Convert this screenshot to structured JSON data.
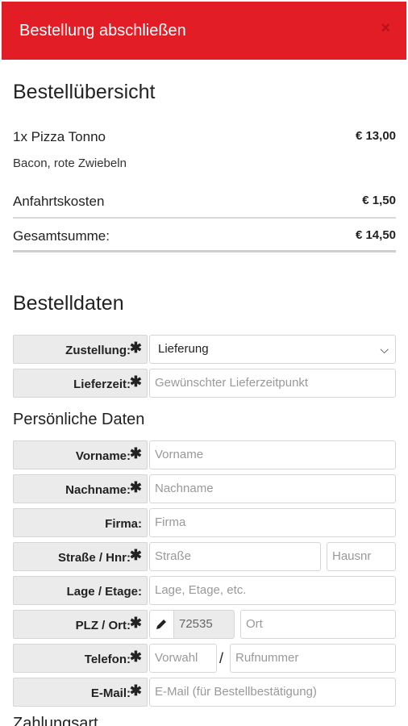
{
  "header": {
    "title": "Bestellung abschließen",
    "close_icon": "close-icon"
  },
  "summary": {
    "title": "Bestellübersicht",
    "item": {
      "name": "1x Pizza Tonno",
      "price": "€ 13,00",
      "extras": "Bacon, rote Zwiebeln"
    },
    "delivery": {
      "label": "Anfahrtskosten",
      "price": "€ 1,50"
    },
    "total": {
      "label": "Gesamtsumme:",
      "price": "€ 14,50"
    }
  },
  "order_data": {
    "title": "Bestelldaten",
    "delivery_type": {
      "label": "Zustellung:",
      "value": "Lieferung"
    },
    "delivery_time": {
      "label": "Lieferzeit:",
      "placeholder": "Gewünschter Lieferzeitpunkt"
    }
  },
  "personal": {
    "title": "Persönliche Daten",
    "firstname": {
      "label": "Vorname:",
      "placeholder": "Vorname"
    },
    "lastname": {
      "label": "Nachname:",
      "placeholder": "Nachname"
    },
    "company": {
      "label": "Firma:",
      "placeholder": "Firma"
    },
    "street": {
      "label": "Straße / Hnr:",
      "placeholder": "Straße",
      "number_placeholder": "Hausnr"
    },
    "location": {
      "label": "Lage / Etage:",
      "placeholder": "Lage, Etage, etc."
    },
    "zip_city": {
      "label": "PLZ / Ort:",
      "zip": "72535",
      "city_placeholder": "Ort"
    },
    "phone": {
      "label": "Telefon:",
      "area_placeholder": "Vorwahl",
      "slash": "/",
      "number_placeholder": "Rufnummer"
    },
    "email": {
      "label": "E-Mail:",
      "placeholder": "E-Mail (für Bestellbestätigung)"
    }
  },
  "payment": {
    "title": "Zahlungsart"
  },
  "required_marker": "✱",
  "colors": {
    "header_bg": "#e21d25",
    "label_bg": "#ebebeb"
  }
}
